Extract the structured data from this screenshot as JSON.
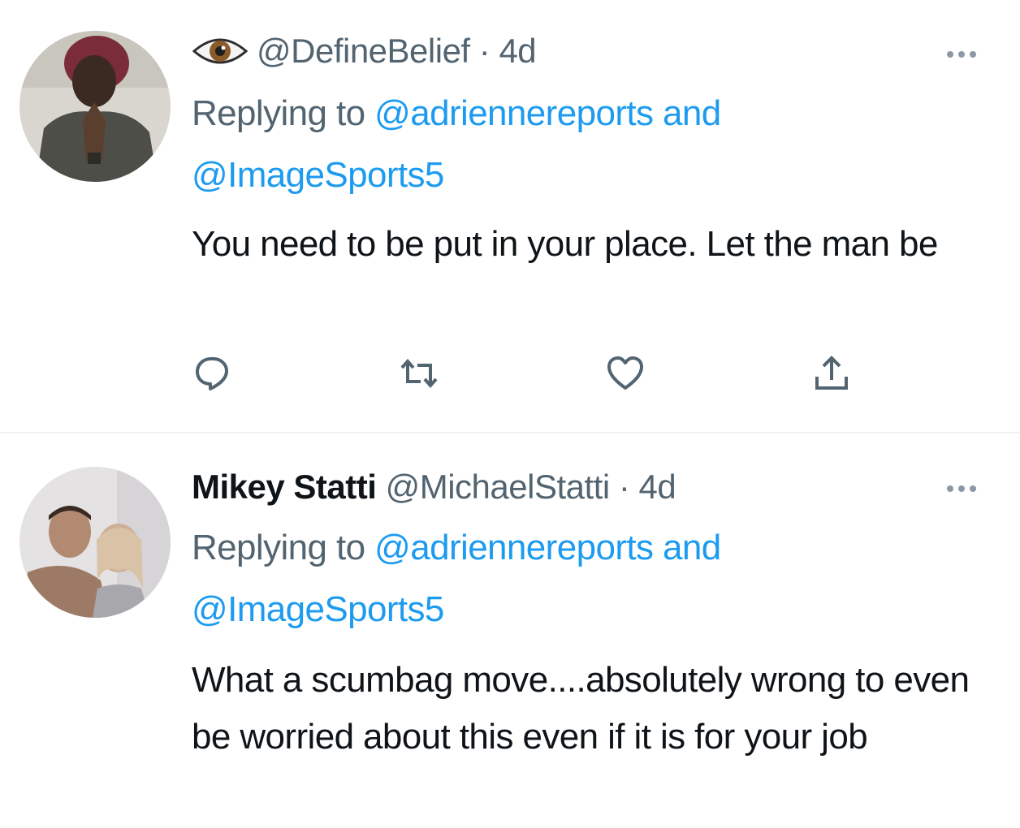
{
  "colors": {
    "primary_text": "#0f1419",
    "secondary_text": "#536471",
    "link": "#1d9bf0",
    "divider": "#eff3f4"
  },
  "tweets": [
    {
      "display_name": "",
      "name_emoji_icon": "eye-icon",
      "handle": "@DefineBelief",
      "separator": " · ",
      "time": "4d",
      "replying_prefix": "Replying to ",
      "mention_1": "@adriennereports",
      "mention_joiner": " and",
      "mention_2": "@ImageSports5",
      "text": "You need to be put in your place. Let the man be",
      "actions": [
        "reply-icon",
        "retweet-icon",
        "like-icon",
        "share-icon"
      ]
    },
    {
      "display_name": "Mikey Statti",
      "handle": "@MichaelStatti",
      "separator": " · ",
      "time": "4d",
      "replying_prefix": "Replying to ",
      "mention_1": "@adriennereports",
      "mention_joiner": " and",
      "mention_2": "@ImageSports5",
      "text": "What a scumbag move....absolutely wrong to even be worried about this even if it is for your job"
    }
  ]
}
